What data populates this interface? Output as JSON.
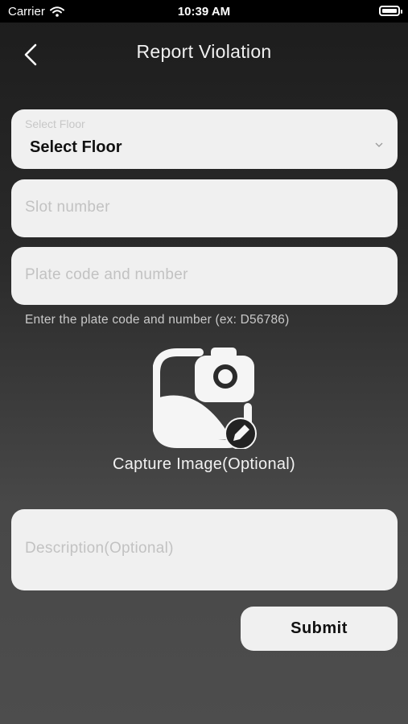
{
  "status_bar": {
    "carrier": "Carrier",
    "time": "10:39 AM"
  },
  "header": {
    "title": "Report Violation",
    "back_icon": "chevron-left-icon"
  },
  "form": {
    "floor": {
      "label": "Select Floor",
      "value": "Select Floor",
      "icon": "chevron-down-icon"
    },
    "slot": {
      "placeholder": "Slot number"
    },
    "plate": {
      "placeholder": "Plate code and number",
      "hint": "Enter the plate code and number (ex: D56786)"
    },
    "capture": {
      "label": "Capture Image(Optional)",
      "icon": "image-camera-icon",
      "edit_icon": "pencil-icon"
    },
    "description": {
      "placeholder": "Description(Optional)"
    },
    "submit_label": "Submit"
  },
  "colors": {
    "field_bg": "#f0f0f0",
    "placeholder": "#c2c2c2",
    "status_bar": "#000000"
  }
}
